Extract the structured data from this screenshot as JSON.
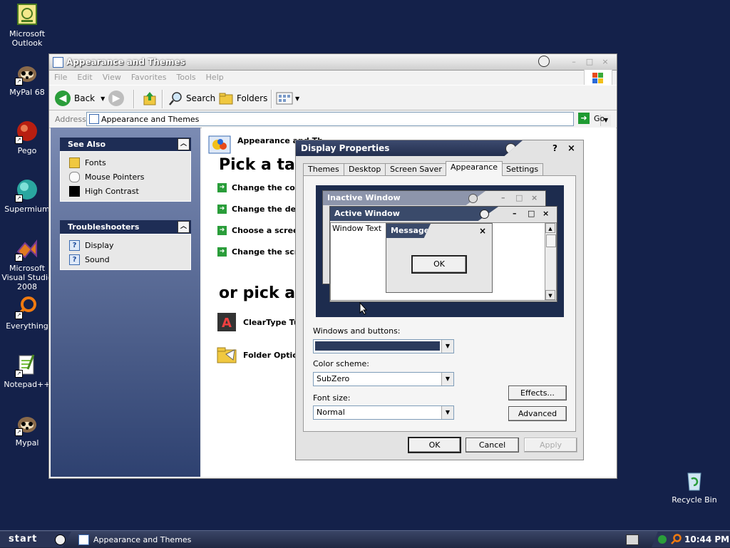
{
  "desktop": {
    "icons": [
      {
        "label": "Microsoft Outlook"
      },
      {
        "label": "MyPal 68"
      },
      {
        "label": "Pego"
      },
      {
        "label": "Supermium"
      },
      {
        "label": "Microsoft Visual Studio 2008"
      },
      {
        "label": "Everything"
      },
      {
        "label": "Notepad++"
      },
      {
        "label": "Mypal"
      },
      {
        "label": "Recycle Bin"
      }
    ]
  },
  "explorer": {
    "title": "Appearance and Themes",
    "menu": [
      "File",
      "Edit",
      "View",
      "Favorites",
      "Tools",
      "Help"
    ],
    "toolbar": {
      "back": "Back",
      "search": "Search",
      "folders": "Folders"
    },
    "address": {
      "label": "Address",
      "value": "Appearance and Themes",
      "go": "Go"
    },
    "see_also": {
      "title": "See Also",
      "items": [
        "Fonts",
        "Mouse Pointers",
        "High Contrast"
      ]
    },
    "troubleshooters": {
      "title": "Troubleshooters",
      "items": [
        "Display",
        "Sound"
      ]
    },
    "main": {
      "category_title": "Appearance and Th",
      "pick_task": "Pick a tas",
      "tasks": [
        "Change the com",
        "Change the desk",
        "Choose a screen",
        "Change the scre"
      ],
      "pick_icon": "or pick a",
      "icons": [
        "ClearType Tun",
        "Folder Option"
      ]
    }
  },
  "dialog": {
    "title": "Display Properties",
    "help": "?",
    "close": "×",
    "tabs": [
      "Themes",
      "Desktop",
      "Screen Saver",
      "Appearance",
      "Settings"
    ],
    "active_tab": "Appearance",
    "preview": {
      "inactive_title": "Inactive Window",
      "active_title": "Active Window",
      "window_text": "Window Text",
      "message_title": "Message B...",
      "message_ok": "OK"
    },
    "windows_buttons_label": "Windows and buttons:",
    "windows_buttons_value": "",
    "color_scheme_label": "Color scheme:",
    "color_scheme_value": "SubZero",
    "font_size_label": "Font size:",
    "font_size_value": "Normal",
    "effects": "Effects...",
    "advanced": "Advanced",
    "ok": "OK",
    "cancel": "Cancel",
    "apply": "Apply"
  },
  "taskbar": {
    "start": "start",
    "task": "Appearance and Themes",
    "clock": "10:44 PM"
  },
  "colors": {
    "desktop": "#14214a",
    "titlebar": "#232f4f",
    "accent_green": "#2a9d3a"
  }
}
